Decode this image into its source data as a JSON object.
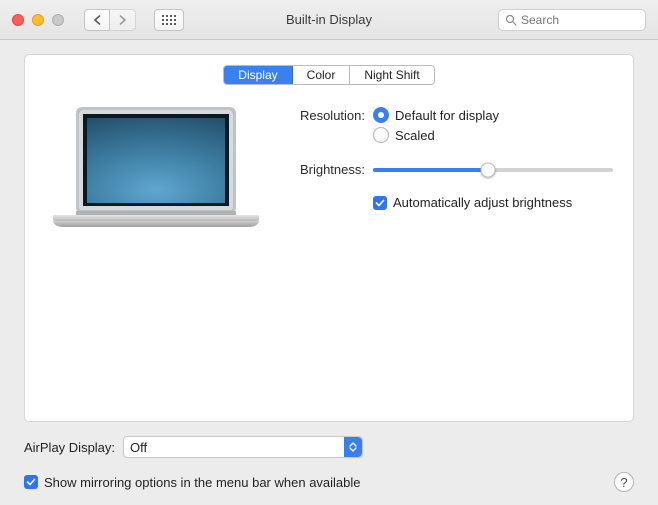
{
  "window": {
    "title": "Built-in Display"
  },
  "search": {
    "placeholder": "Search"
  },
  "tabs": {
    "display": "Display",
    "color": "Color",
    "night_shift": "Night Shift"
  },
  "controls": {
    "resolution_label": "Resolution:",
    "resolution_default": "Default for display",
    "resolution_scaled": "Scaled",
    "brightness_label": "Brightness:",
    "brightness_percent": 48,
    "auto_adjust": "Automatically adjust brightness"
  },
  "airplay": {
    "label": "AirPlay Display:",
    "value": "Off",
    "mirroring": "Show mirroring options in the menu bar when available"
  },
  "help": "?"
}
